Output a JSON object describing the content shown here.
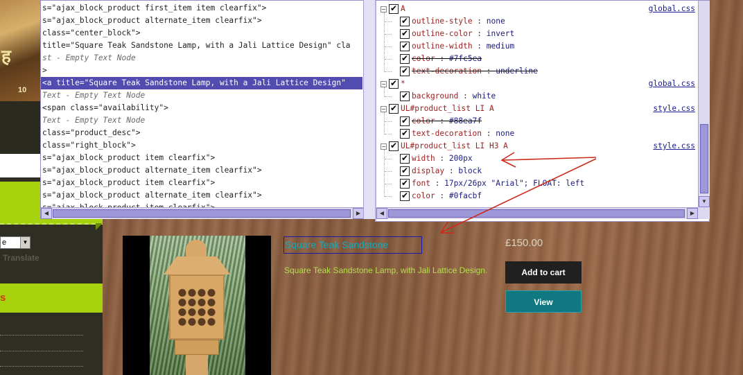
{
  "sidebar": {
    "banner_glyph": "ह",
    "banner_number": "10",
    "language_value": "e",
    "translate_label": "Translate",
    "section_marker": "s",
    "select_arrow": "▼"
  },
  "html_panel": {
    "lines": [
      {
        "kind": "normal",
        "text": "s=\"ajax_block_product first_item item clearfix\">"
      },
      {
        "kind": "normal",
        "text": "s=\"ajax_block_product  alternate_item clearfix\">"
      },
      {
        "kind": "normal",
        "text": "class=\"center_block\">"
      },
      {
        "kind": "normal",
        "text": " title=\"Square Teak Sandstone Lamp, with a Jali Lattice Design\" cla"
      },
      {
        "kind": "comment",
        "text": "st - Empty Text Node"
      },
      {
        "kind": "normal",
        "text": ">"
      },
      {
        "kind": "selected",
        "text": "<a title=\"Square Teak Sandstone Lamp, with a Jali Lattice Design\""
      },
      {
        "kind": "comment",
        "text": "Text - Empty Text Node"
      },
      {
        "kind": "normal",
        "text": "<span class=\"availability\">"
      },
      {
        "kind": "comment",
        "text": "Text - Empty Text Node"
      },
      {
        "kind": "normal",
        "text": " class=\"product_desc\">"
      },
      {
        "kind": "normal",
        "text": "class=\"right_block\">"
      },
      {
        "kind": "normal",
        "text": "s=\"ajax_block_product  item clearfix\">"
      },
      {
        "kind": "normal",
        "text": "s=\"ajax_block_product  alternate_item clearfix\">"
      },
      {
        "kind": "normal",
        "text": "s=\"ajax_block_product  item clearfix\">"
      },
      {
        "kind": "normal",
        "text": "s=\"ajax_block_product  alternate_item clearfix\">"
      },
      {
        "kind": "normal",
        "text": "s=\"ajax_block_product  item clearfix\">"
      }
    ]
  },
  "css_panel": {
    "rules": [
      {
        "selector": "A",
        "source": "global.css",
        "props": [
          {
            "name": "outline-style",
            "value": "none",
            "struck": false
          },
          {
            "name": "outline-color",
            "value": "invert",
            "struck": false
          },
          {
            "name": "outline-width",
            "value": "medium",
            "struck": false
          },
          {
            "name": "color",
            "value": "#7fc5ea",
            "struck": true
          },
          {
            "name": "text-decoration",
            "value": "underline",
            "struck": true
          }
        ]
      },
      {
        "selector": "*",
        "source": "global.css",
        "props": [
          {
            "name": "background",
            "value": "white",
            "struck": false
          }
        ]
      },
      {
        "selector": "UL#product_list LI A",
        "source": "style.css",
        "props": [
          {
            "name": "color",
            "value": "#88ea7f",
            "struck": true
          },
          {
            "name": "text-decoration",
            "value": "none",
            "struck": false
          }
        ]
      },
      {
        "selector": "UL#product_list LI H3 A",
        "source": "style.css",
        "props": [
          {
            "name": "width",
            "value": "200px",
            "struck": false
          },
          {
            "name": "display",
            "value": "block",
            "struck": false
          },
          {
            "name": "font",
            "value": "17px/26px \"Arial\"; FLOAT: left",
            "struck": false
          },
          {
            "name": "color",
            "value": "#0facbf",
            "struck": false
          }
        ]
      }
    ],
    "check_glyph": "✔",
    "collapse_glyph": "−",
    "colon": " : "
  },
  "scroll": {
    "left_arrow": "◀",
    "right_arrow": "▶",
    "down_arrow": "▼"
  },
  "product": {
    "title": "Square Teak Sandstone",
    "description": "Square Teak Sandstone Lamp, with Jali Lattice Design.",
    "price": "£150.00",
    "add_to_cart_label": "Add to cart",
    "view_label": "View"
  },
  "colors": {
    "accent_green": "#a6d30d",
    "selection": "#524bb0",
    "title_link": "#0facbf",
    "annotation_red": "#cc2a1a"
  }
}
